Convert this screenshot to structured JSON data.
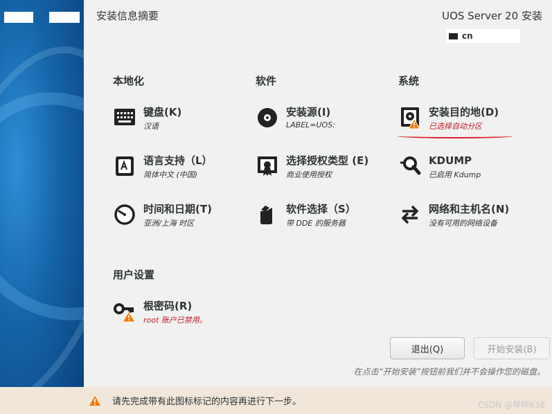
{
  "header": {
    "page_title": "安装信息摘要",
    "product_title": "UOS Server 20 安装",
    "keyboard_layout": "cn"
  },
  "sections": {
    "localization": "本地化",
    "software": "软件",
    "system": "系统",
    "user_settings": "用户设置"
  },
  "spokes": {
    "keyboard": {
      "title": "键盘(K)",
      "status": "汉语",
      "icon": "keyboard-icon"
    },
    "language": {
      "title": "语言支持（L）",
      "status": "简体中文 (中国)",
      "icon": "language-icon"
    },
    "datetime": {
      "title": "时间和日期(T)",
      "status": "亚洲/上海 时区",
      "icon": "clock-icon"
    },
    "source": {
      "title": "安装源(I)",
      "status": "LABEL=UOS:",
      "icon": "disc-icon"
    },
    "license": {
      "title": "选择授权类型 (E)",
      "status": "商业使用授权",
      "icon": "license-icon"
    },
    "software": {
      "title": "软件选择（S）",
      "status": "带 DDE 的服务器",
      "icon": "package-icon"
    },
    "destination": {
      "title": "安装目的地(D)",
      "status": "已选择自动分区",
      "icon": "harddisk-warning-icon"
    },
    "kdump": {
      "title": "KDUMP",
      "status": "已启用 Kdump",
      "icon": "search-icon"
    },
    "network": {
      "title": "网络和主机名(N)",
      "status": "没有可用的网络设备",
      "icon": "arrows-icon"
    },
    "root": {
      "title": "根密码(R)",
      "status": "root 账户已禁用。",
      "icon": "key-warning-icon"
    }
  },
  "buttons": {
    "quit": "退出(Q)",
    "begin": "开始安装(B)"
  },
  "note": "在点击“开始安装”按钮前我们并不会操作您的磁盘。",
  "warning_bar": "请先完成带有此图标标记的内容再进行下一步。",
  "watermark": "CSDN @琴畔638",
  "colors": {
    "warning": "#f57900",
    "error_text": "#c01c28",
    "sidebar": "#1564a8",
    "warning_bar_bg": "#f0e6d9"
  }
}
